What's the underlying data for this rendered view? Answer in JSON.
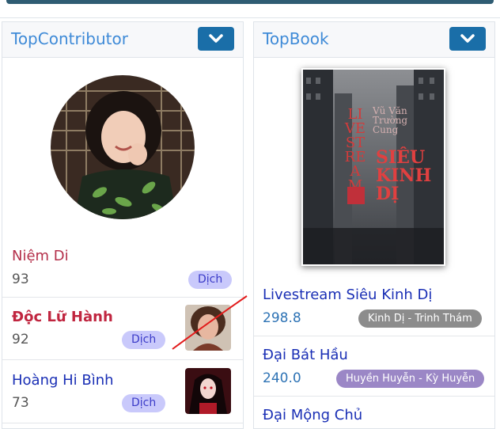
{
  "contributors_panel": {
    "title": "TopContributor",
    "items": [
      {
        "name": "Niệm Di",
        "score": "93",
        "badge": "Dịch"
      },
      {
        "name": "Độc Lữ Hành",
        "score": "92",
        "badge": "Dịch"
      },
      {
        "name": "Hoàng Hi Bình",
        "score": "73",
        "badge": "Dịch"
      }
    ]
  },
  "books_panel": {
    "title": "TopBook",
    "cover": {
      "author": "Vũ Văn\nTrường\nCung",
      "title_vertical": "LIVE STREAM",
      "title_main": "SIÊU\nKINH\nDỊ"
    },
    "items": [
      {
        "title": "Livestream Siêu Kinh Dị",
        "score": "298.8",
        "genre": "Kinh Dị - Trinh Thám"
      },
      {
        "title": "Đại Bát Hầu",
        "score": "240.0",
        "genre": "Huyền Huyễn - Kỳ Huyễn"
      },
      {
        "title": "Đại Mộng Chủ"
      }
    ]
  },
  "colors": {
    "accent_blue": "#1a6ea8",
    "genre_gray": "#8c8c8c",
    "genre_purple": "#9b87c6",
    "contributor_red": "#c0253f"
  }
}
